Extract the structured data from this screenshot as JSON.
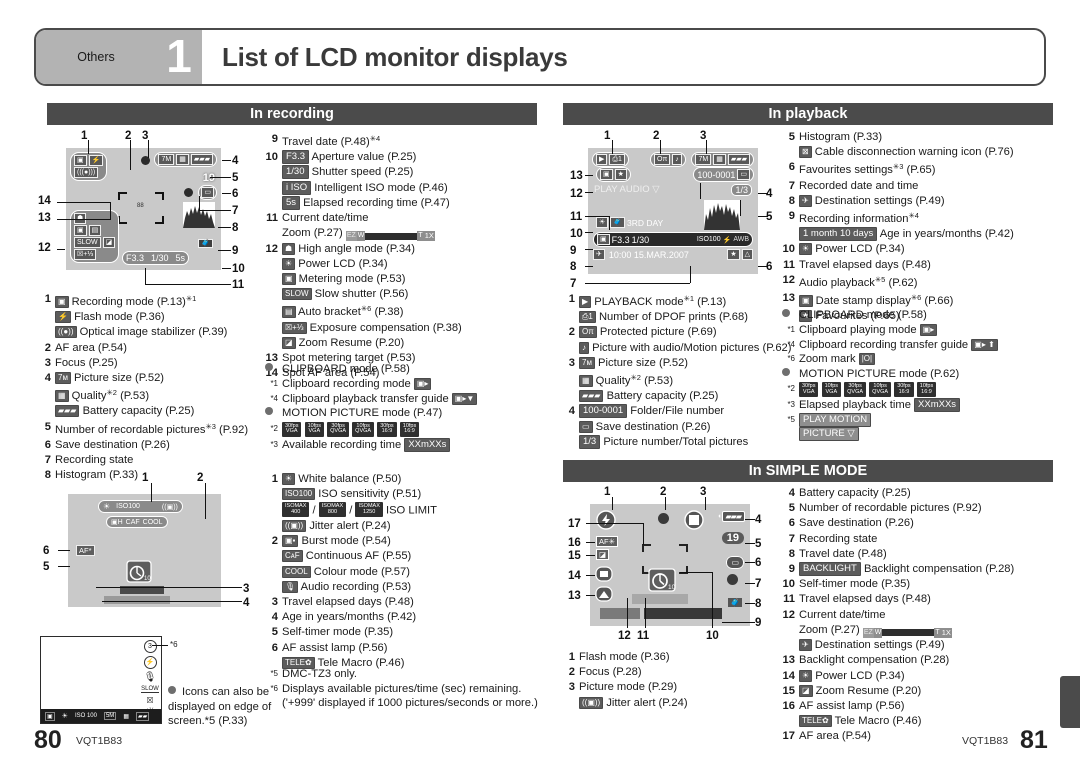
{
  "header": {
    "chapter_tab": "Others",
    "chapter_number": "1",
    "title": "List of LCD monitor displays"
  },
  "sections": {
    "recording": "In recording",
    "playback": "In playback",
    "simple": "In SIMPLE MODE"
  },
  "recording_list": [
    {
      "n": "1",
      "text": "Recording mode (P.13)*1",
      "icon": "camera-icon"
    },
    {
      "n": "",
      "text": "Flash mode (P.36)",
      "icon": "flash-icon"
    },
    {
      "n": "",
      "text": "Optical image stabilizer (P.39)",
      "icon": "ois-icon"
    },
    {
      "n": "2",
      "text": "AF area (P.54)"
    },
    {
      "n": "3",
      "text": "Focus (P.25)"
    },
    {
      "n": "4",
      "text": "Picture size (P.52)",
      "icon": "7M"
    },
    {
      "n": "",
      "text": "Quality*2 (P.53)",
      "icon": "quality-icon"
    },
    {
      "n": "",
      "text": "Battery capacity (P.25)",
      "icon": "battery-icon"
    },
    {
      "n": "5",
      "text": "Number of recordable pictures*3 (P.92)"
    },
    {
      "n": "6",
      "text": "Save destination (P.26)"
    },
    {
      "n": "7",
      "text": "Recording state"
    },
    {
      "n": "8",
      "text": "Histogram (P.33)"
    }
  ],
  "recording_list2": [
    {
      "n": "9",
      "text": "Travel date (P.48)*4"
    },
    {
      "n": "10",
      "text": "Aperture value (P.25)",
      "chip": "F3.3"
    },
    {
      "n": "",
      "text": "Shutter speed (P.25)",
      "chip": "1/30"
    },
    {
      "n": "",
      "text": "Intelligent ISO mode (P.46)",
      "chip": "i ISO"
    },
    {
      "n": "",
      "text": "Elapsed recording time (P.47)",
      "chip": "5s"
    },
    {
      "n": "11",
      "text": "Current date/time"
    },
    {
      "n": "",
      "text": "Zoom (P.27)",
      "zoombar": true
    },
    {
      "n": "12",
      "text": "High angle mode (P.34)",
      "icon": "high-angle-icon"
    },
    {
      "n": "",
      "text": "Power LCD (P.34)",
      "icon": "power-lcd-icon"
    },
    {
      "n": "",
      "text": "Metering mode (P.53)",
      "icon": "metering-icon"
    },
    {
      "n": "",
      "text": "Slow shutter (P.56)",
      "icon": "slow-shutter-icon"
    },
    {
      "n": "",
      "text": "Auto bracket*6 (P.38)",
      "icon": "auto-bracket-icon"
    },
    {
      "n": "",
      "text": "Exposure compensation (P.38)",
      "icon": "exposure-comp-icon"
    },
    {
      "n": "",
      "text": "Zoom Resume (P.20)",
      "icon": "zoom-resume-icon"
    },
    {
      "n": "13",
      "text": "Spot metering target (P.53)"
    },
    {
      "n": "14",
      "text": "Spot AF area (P.54)"
    }
  ],
  "recording_notes": [
    {
      "kind": "bullet",
      "text": "CLIPBOARD mode (P.58)"
    },
    {
      "kind": "star",
      "mark": "*1",
      "text": "Clipboard recording mode",
      "icon": "clipboard-rec-icon"
    },
    {
      "kind": "star",
      "mark": "*4",
      "text": "Clipboard playback transfer guide",
      "icon": "clipboard-transfer-icon"
    },
    {
      "kind": "bullet",
      "text": "MOTION PICTURE mode (P.47)"
    },
    {
      "kind": "star",
      "mark": "*2",
      "text": "",
      "fps": true
    },
    {
      "kind": "star",
      "mark": "*3",
      "text": "Available recording time",
      "chip": "XXmXXs"
    }
  ],
  "lower_left_list": [
    {
      "n": "1",
      "text": "White balance (P.50)",
      "icon": "white-balance-icon"
    },
    {
      "n": "",
      "text": "ISO sensitivity (P.51)",
      "icon": "ISO100"
    },
    {
      "n": "",
      "text": "ISO LIMIT",
      "iso_limit": [
        "400",
        "800",
        "1250"
      ]
    },
    {
      "n": "",
      "text": "Jitter alert (P.24)",
      "icon": "jitter-icon"
    },
    {
      "n": "2",
      "text": "Burst mode (P.54)",
      "icon": "burst-icon"
    },
    {
      "n": "",
      "text": "Continuous AF (P.55)",
      "icon": "CAF"
    },
    {
      "n": "",
      "text": "Colour mode (P.57)",
      "icon": "COOL"
    },
    {
      "n": "",
      "text": "Audio recording (P.53)",
      "icon": "mic-icon"
    },
    {
      "n": "3",
      "text": "Travel elapsed days (P.48)"
    },
    {
      "n": "4",
      "text": "Age in years/months (P.42)"
    },
    {
      "n": "5",
      "text": "Self-timer mode (P.35)"
    },
    {
      "n": "6",
      "text": "AF assist lamp (P.56)"
    },
    {
      "n": "",
      "text": "Tele Macro (P.46)",
      "icon": "tele-macro-icon"
    }
  ],
  "lower_left_notes": [
    {
      "mark": "*5",
      "text": "DMC-TZ3 only."
    },
    {
      "mark": "*6",
      "text": "Displays available pictures/time (sec) remaining."
    },
    {
      "mark": "",
      "text": "('+999' displayed if 1000 pictures/seconds or more.)"
    }
  ],
  "edge_note": "Icons can also be displayed on edge of screen.*5 (P.33)",
  "edge_note_mark": "*6",
  "playback_list": [
    {
      "n": "1",
      "text": "PLAYBACK mode*1 (P.13)",
      "icon": "playback-icon"
    },
    {
      "n": "",
      "text": "Number of DPOF prints (P.68)",
      "icon": "dpof-icon"
    },
    {
      "n": "2",
      "text": "Protected picture (P.69)",
      "icon": "protect-icon"
    },
    {
      "n": "",
      "text": "Picture with audio/Motion pictures (P.62)",
      "icon": "audio-picture-icon"
    },
    {
      "n": "3",
      "text": "Picture size (P.52)",
      "icon": "7M"
    },
    {
      "n": "",
      "text": "Quality*2 (P.53)",
      "icon": "quality-icon"
    },
    {
      "n": "",
      "text": "Battery capacity (P.25)",
      "icon": "battery-icon"
    },
    {
      "n": "4",
      "text": "Folder/File number",
      "chip": "100-0001"
    },
    {
      "n": "",
      "text": "Save destination (P.26)",
      "icon": "save-dest-icon"
    },
    {
      "n": "",
      "text": "Picture number/Total pictures",
      "chip": "1/3"
    }
  ],
  "playback_list2": [
    {
      "n": "5",
      "text": "Histogram (P.33)"
    },
    {
      "n": "",
      "text": "Cable disconnection warning icon (P.76)",
      "icon": "cable-warning-icon"
    },
    {
      "n": "6",
      "text": "Favourites settings*3 (P.65)"
    },
    {
      "n": "7",
      "text": "Recorded date and time"
    },
    {
      "n": "8",
      "text": "Destination settings (P.49)",
      "icon": "destination-icon"
    },
    {
      "n": "9",
      "text": "Recording information*4"
    },
    {
      "n": "",
      "text": "Age in years/months (P.42)",
      "chip": "1 month 10 days"
    },
    {
      "n": "10",
      "text": "Power LCD (P.34)",
      "icon": "power-lcd-icon"
    },
    {
      "n": "11",
      "text": "Travel elapsed days (P.48)"
    },
    {
      "n": "12",
      "text": "Audio playback*5 (P.62)"
    },
    {
      "n": "13",
      "text": "Date stamp display*6 (P.66)",
      "icon": "date-stamp-icon"
    },
    {
      "n": "",
      "text": "Favourites (P.65)",
      "icon": "favourites-icon"
    }
  ],
  "playback_notes": [
    {
      "kind": "bullet",
      "text": "CLIPBOARD mode (P.58)"
    },
    {
      "kind": "star",
      "mark": "*1",
      "text": "Clipboard playing mode",
      "icon": "clipboard-play-icon"
    },
    {
      "kind": "star",
      "mark": "*4",
      "text": "Clipboard recording transfer guide",
      "icon": "clipboard-rec-transfer-icon"
    },
    {
      "kind": "star",
      "mark": "*6",
      "text": "Zoom mark",
      "icon": "zoom-mark-icon"
    },
    {
      "kind": "bullet",
      "text": "MOTION PICTURE mode (P.62)"
    },
    {
      "kind": "star",
      "mark": "*2",
      "text": "",
      "fps": true
    },
    {
      "kind": "star",
      "mark": "*3",
      "text": "Elapsed playback time",
      "chip": "XXmXXs"
    },
    {
      "kind": "star",
      "mark": "*5",
      "text": "",
      "chip2": [
        "PLAY MOTION",
        "PICTURE"
      ]
    }
  ],
  "simple_list_left": [
    {
      "n": "1",
      "text": "Flash mode (P.36)"
    },
    {
      "n": "2",
      "text": "Focus (P.28)"
    },
    {
      "n": "3",
      "text": "Picture mode (P.29)"
    },
    {
      "n": "",
      "text": "Jitter alert (P.24)",
      "icon": "jitter-icon"
    }
  ],
  "simple_list_right": [
    {
      "n": "4",
      "text": "Battery capacity (P.25)"
    },
    {
      "n": "5",
      "text": "Number of recordable pictures (P.92)"
    },
    {
      "n": "6",
      "text": "Save destination (P.26)"
    },
    {
      "n": "7",
      "text": "Recording state"
    },
    {
      "n": "8",
      "text": "Travel date (P.48)"
    },
    {
      "n": "9",
      "text": "Backlight compensation (P.28)",
      "chip": "BACKLIGHT"
    },
    {
      "n": "10",
      "text": "Self-timer mode (P.35)"
    },
    {
      "n": "11",
      "text": "Travel elapsed days (P.48)"
    },
    {
      "n": "12",
      "text": "Current date/time"
    },
    {
      "n": "",
      "text": "Zoom (P.27)",
      "zoombar": true
    },
    {
      "n": "",
      "text": "Destination settings (P.49)",
      "icon": "destination-icon"
    },
    {
      "n": "13",
      "text": "Backlight compensation (P.28)"
    },
    {
      "n": "14",
      "text": "Power LCD (P.34)",
      "icon": "power-lcd-icon"
    },
    {
      "n": "15",
      "text": "Zoom Resume (P.20)",
      "icon": "zoom-resume-icon"
    },
    {
      "n": "16",
      "text": "AF assist lamp (P.56)"
    },
    {
      "n": "",
      "text": "Tele Macro (P.46)",
      "icon": "tele-macro-icon"
    },
    {
      "n": "17",
      "text": "AF area (P.54)"
    }
  ],
  "lcd_recording": {
    "picture_size": "7M",
    "recordable": "19",
    "aperture": "F3.3",
    "shutter": "1/30",
    "elapsed": "5s",
    "spot": "88",
    "callouts_top": [
      "1",
      "2",
      "3"
    ],
    "callouts_right": [
      "4",
      "5",
      "6",
      "7",
      "8",
      "9",
      "10",
      "11"
    ],
    "callouts_left": [
      "14",
      "13",
      "12"
    ]
  },
  "lcd_playback": {
    "dpof": "1",
    "picture_size": "7M",
    "folder_file": "100-0001",
    "play_audio": "PLAY AUDIO",
    "page": "1/3",
    "travel_day": "3RD DAY",
    "aperture": "F3.3",
    "shutter": "1/30",
    "iso": "ISO100",
    "awb": "AWB",
    "datetime": "10:00  15.MAR.2007",
    "callouts_top": [
      "1",
      "2",
      "3"
    ],
    "callouts_left": [
      "3",
      "2",
      "1",
      "13",
      "12",
      "11",
      "10",
      "9",
      "8",
      "7"
    ],
    "callouts_right": [
      "5",
      "6",
      "7",
      "8",
      "9",
      "10",
      "11",
      "12",
      "13",
      "4",
      "5",
      "6"
    ]
  },
  "lcd_lower_left": {
    "iso": "ISO100",
    "white_balance": "wb-icon",
    "jitter": "jitter-icon",
    "burst": "burst-icon",
    "caf": "CAF",
    "cool": "COOL",
    "af_star": "AF*",
    "self_timer": "10",
    "callouts": [
      "1",
      "2",
      "3",
      "4",
      "5",
      "6"
    ]
  },
  "lcd_simple": {
    "recordable": "19",
    "self_timer": "10",
    "callouts_top": [
      "1",
      "2",
      "3"
    ],
    "callouts_right": [
      "4",
      "5",
      "6",
      "7",
      "8",
      "9"
    ],
    "callouts_left": [
      "17",
      "16",
      "15",
      "14",
      "13"
    ],
    "callouts_bottom": [
      "12",
      "11",
      "10"
    ]
  },
  "footer": {
    "left_page": "80",
    "left_code": "VQT1B83",
    "right_page": "81",
    "right_code": "VQT1B83"
  }
}
